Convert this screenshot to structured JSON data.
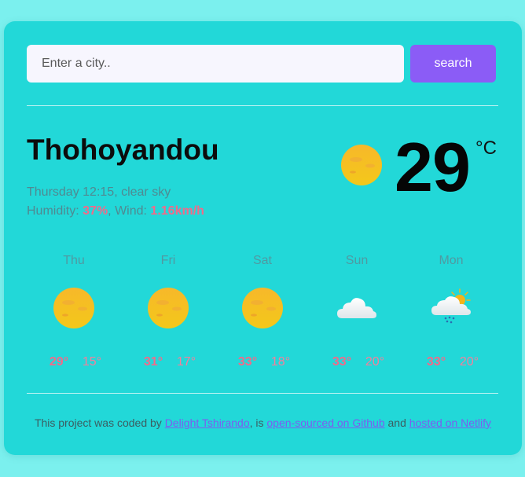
{
  "search": {
    "placeholder": "Enter a city..",
    "button_label": "search"
  },
  "current": {
    "city": "Thohoyandou",
    "datetime": "Thursday 12:15",
    "description": "clear sky",
    "humidity_label": "Humidity:",
    "humidity": "37%",
    "wind_label": "Wind:",
    "wind": "1.16km/h",
    "temperature": "29",
    "unit": "°C",
    "icon": "sun-icon"
  },
  "forecast": [
    {
      "day": "Thu",
      "max": "29°",
      "min": "15°",
      "icon": "sun-icon"
    },
    {
      "day": "Fri",
      "max": "31°",
      "min": "17°",
      "icon": "sun-icon"
    },
    {
      "day": "Sat",
      "max": "33°",
      "min": "18°",
      "icon": "sun-icon"
    },
    {
      "day": "Sun",
      "max": "33°",
      "min": "20°",
      "icon": "cloud-icon"
    },
    {
      "day": "Mon",
      "max": "33°",
      "min": "20°",
      "icon": "sun-cloud-rain-icon"
    }
  ],
  "footer": {
    "text1": "This project was coded by",
    "author_link": "Delight Tshirando",
    "text2": ", is",
    "source_link": "open-sourced on Github",
    "text3": "and",
    "hosting_link": "hosted on Netlify"
  },
  "colors": {
    "background": "#7bf0ee",
    "card": "#22d8d8",
    "accent_button": "#8b5cf6",
    "highlight": "#f06b8a",
    "link": "#7c5cf0"
  }
}
